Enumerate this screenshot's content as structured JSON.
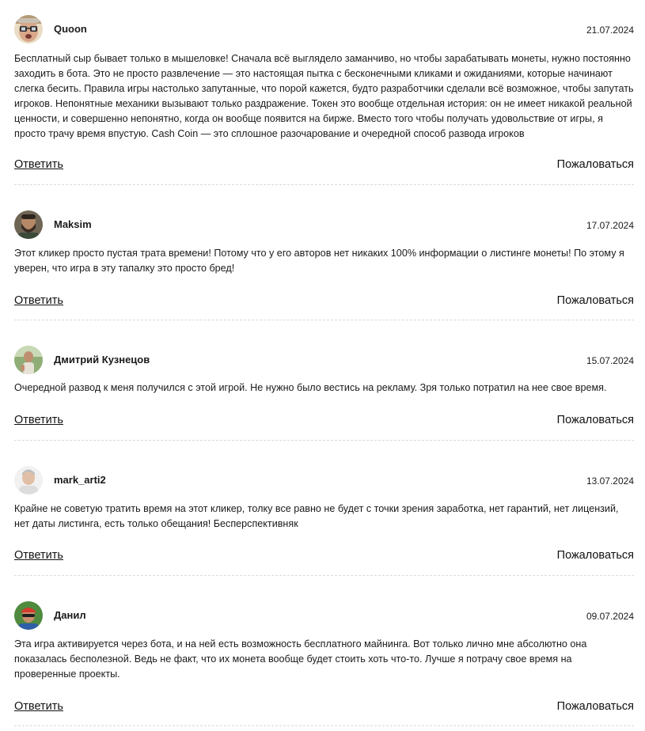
{
  "comments": [
    {
      "author": "Quoon",
      "date": "21.07.2024",
      "avatar": "avatar-glasses-man",
      "text": "Бесплатный сыр бывает только в мышеловке! Сначала всё выглядело заманчиво, но чтобы зарабатывать монеты, нужно постоянно заходить в бота. Это не просто развлечение — это настоящая пытка с бесконечными кликами и ожиданиями, которые начинают слегка бесить. Правила игры настолько запутанные, что порой кажется, будто разработчики сделали всё возможное, чтобы запутать игроков. Непонятные механики вызывают только раздражение. Токен это вообще отдельная история: он не имеет никакой реальной ценности, и совершенно непонятно, когда он вообще появится на бирже. Вместо того чтобы получать удовольствие от игры, я просто трачу время впустую. Cash Coin — это сплошное разочарование и очередной способ развода игроков",
      "reply_label": "Ответить",
      "report_label": "Пожаловаться"
    },
    {
      "author": "Maksim",
      "date": "17.07.2024",
      "avatar": "avatar-bearded-man",
      "text": "Этот кликер просто пустая трата времени! Потому что у его авторов нет никаких 100% информации о листинге монеты! По этому я уверен, что игра в эту тапалку это просто бред!",
      "reply_label": "Ответить",
      "report_label": "Пожаловаться"
    },
    {
      "author": "Дмитрий Кузнецов",
      "date": "15.07.2024",
      "avatar": "avatar-outdoor-man",
      "text": "Очередной развод к меня получился с этой игрой. Не нужно было вестись на рекламу. Зря только потратил на нее свое время.",
      "reply_label": "Ответить",
      "report_label": "Пожаловаться"
    },
    {
      "author": "mark_arti2",
      "date": "13.07.2024",
      "avatar": "avatar-gray-hair-man",
      "text": "Крайне не советую тратить время на этот кликер, толку все равно не будет с точки зрения заработка, нет гарантий, нет лицензий, нет даты листинга, есть только обещания! Бесперспективняк",
      "reply_label": "Ответить",
      "report_label": "Пожаловаться"
    },
    {
      "author": "Данил",
      "date": "09.07.2024",
      "avatar": "avatar-helmet-man",
      "text": "Эта игра активируется через бота, и на ней есть возможность бесплатного майнинга. Вот только лично мне абсолютно она показалась бесполезной. Ведь не факт, что их монета вообще будет стоить хоть что-то. Лучше я потрачу свое время на проверенные проекты.",
      "reply_label": "Ответить",
      "report_label": "Пожаловаться"
    }
  ]
}
